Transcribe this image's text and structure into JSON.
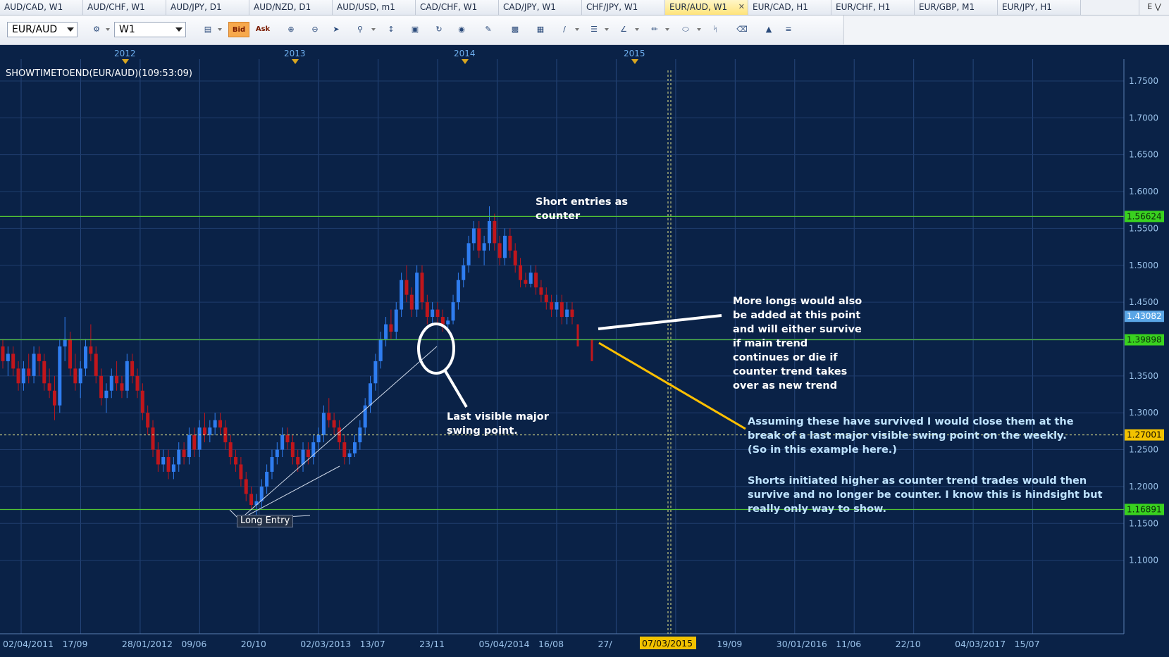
{
  "tabs": [
    {
      "label": "AUD/CAD, W1",
      "active": false
    },
    {
      "label": "AUD/CHF, W1",
      "active": false
    },
    {
      "label": "AUD/JPY, D1",
      "active": false
    },
    {
      "label": "AUD/NZD, D1",
      "active": false
    },
    {
      "label": "AUD/USD, m1",
      "active": false
    },
    {
      "label": "CAD/CHF, W1",
      "active": false
    },
    {
      "label": "CAD/JPY, W1",
      "active": false
    },
    {
      "label": "CHF/JPY, W1",
      "active": false
    },
    {
      "label": "EUR/AUD, W1",
      "active": true
    },
    {
      "label": "EUR/CAD, H1",
      "active": false
    },
    {
      "label": "EUR/CHF, H1",
      "active": false
    },
    {
      "label": "EUR/GBP, M1",
      "active": false
    },
    {
      "label": "EUR/JPY, H1",
      "active": false
    }
  ],
  "tab_more_label": "E",
  "toolbar": {
    "symbol": "EUR/AUD",
    "timeframe": "W1",
    "bid_label": "Bid",
    "ask_label": "Ask"
  },
  "indicator_label": "SHOWTIMETOEND(EUR/AUD)(109:53:09)",
  "annotations": {
    "short_entries": [
      "Short entries as",
      "counter"
    ],
    "more_longs": [
      "More longs would also",
      "be added at this point",
      "and will either survive",
      "if main trend",
      "continues or die if",
      "counter trend takes",
      "over as new trend"
    ],
    "swing_point": [
      "Last visible major",
      "swing point."
    ],
    "assuming": [
      "Assuming these have survived I would close them at the",
      "break of a last major visible swing point on the weekly.",
      "(So in this example here.)"
    ],
    "shorts": [
      "Shorts initiated higher as counter trend trades would then",
      "survive and no longer be counter. I know this is hindsight but",
      "really only way to show."
    ],
    "long_entry": "Long Entry"
  },
  "colors": {
    "background": "#0b2450",
    "bull": "#2f7df0",
    "bear": "#c0161c",
    "level_line": "#52c234",
    "crosshair": "#e6e68a",
    "current_price_tag": "#5aa6e6",
    "level_tag": "#39d11f",
    "crosshair_tag": "#f2c200",
    "arrow_long": "#ffffff",
    "arrow_short": "#ffc000"
  },
  "chart_data": {
    "type": "candlestick",
    "symbol": "EUR/AUD",
    "timeframe": "W1",
    "y_range": [
      1.05,
      1.77
    ],
    "y_ticks": [
      1.1,
      1.15,
      1.2,
      1.25,
      1.3,
      1.35,
      1.4,
      1.45,
      1.5,
      1.55,
      1.6,
      1.65,
      1.7,
      1.75
    ],
    "y_tick_labels": [
      "1.1000",
      "1.1500",
      "1.2000",
      "1.2500",
      "1.3000",
      "1.3500",
      "1.4000",
      "1.4500",
      "1.5000",
      "1.5500",
      "1.6000",
      "1.6500",
      "1.7000",
      "1.7500"
    ],
    "x_tick_labels": [
      "02/04/2011",
      "17/09",
      "28/01/2012",
      "09/06",
      "20/10",
      "02/03/2013",
      "13/07",
      "23/11",
      "05/04/2014",
      "16/08",
      "27/",
      "2015",
      "19/09",
      "30/01/2016",
      "11/06",
      "22/10",
      "04/03/2017",
      "15/07"
    ],
    "year_markers": [
      "2012",
      "2013",
      "2014",
      "2015"
    ],
    "horizontal_levels": [
      {
        "price": 1.56624,
        "label": "1.56624"
      },
      {
        "price": 1.39898,
        "label": "1.39898"
      },
      {
        "price": 1.16891,
        "label": "1.16891"
      }
    ],
    "current_price": {
      "price": 1.43082,
      "label": "1.43082"
    },
    "crosshair": {
      "price": 1.27001,
      "label": "1.27001",
      "date": "07/03/2015"
    },
    "series": [
      {
        "o": 1.39,
        "h": 1.4,
        "l": 1.36,
        "c": 1.37
      },
      {
        "o": 1.37,
        "h": 1.39,
        "l": 1.35,
        "c": 1.38
      },
      {
        "o": 1.38,
        "h": 1.39,
        "l": 1.35,
        "c": 1.36
      },
      {
        "o": 1.36,
        "h": 1.37,
        "l": 1.33,
        "c": 1.34
      },
      {
        "o": 1.34,
        "h": 1.37,
        "l": 1.33,
        "c": 1.36
      },
      {
        "o": 1.36,
        "h": 1.38,
        "l": 1.34,
        "c": 1.35
      },
      {
        "o": 1.35,
        "h": 1.39,
        "l": 1.34,
        "c": 1.38
      },
      {
        "o": 1.38,
        "h": 1.39,
        "l": 1.35,
        "c": 1.37
      },
      {
        "o": 1.37,
        "h": 1.38,
        "l": 1.33,
        "c": 1.34
      },
      {
        "o": 1.34,
        "h": 1.36,
        "l": 1.32,
        "c": 1.33
      },
      {
        "o": 1.33,
        "h": 1.35,
        "l": 1.29,
        "c": 1.31
      },
      {
        "o": 1.31,
        "h": 1.4,
        "l": 1.3,
        "c": 1.39
      },
      {
        "o": 1.39,
        "h": 1.43,
        "l": 1.37,
        "c": 1.4
      },
      {
        "o": 1.4,
        "h": 1.41,
        "l": 1.35,
        "c": 1.36
      },
      {
        "o": 1.36,
        "h": 1.38,
        "l": 1.33,
        "c": 1.34
      },
      {
        "o": 1.34,
        "h": 1.37,
        "l": 1.32,
        "c": 1.36
      },
      {
        "o": 1.36,
        "h": 1.4,
        "l": 1.35,
        "c": 1.39
      },
      {
        "o": 1.39,
        "h": 1.42,
        "l": 1.37,
        "c": 1.38
      },
      {
        "o": 1.38,
        "h": 1.39,
        "l": 1.34,
        "c": 1.35
      },
      {
        "o": 1.35,
        "h": 1.36,
        "l": 1.31,
        "c": 1.32
      },
      {
        "o": 1.32,
        "h": 1.34,
        "l": 1.3,
        "c": 1.33
      },
      {
        "o": 1.33,
        "h": 1.36,
        "l": 1.32,
        "c": 1.35
      },
      {
        "o": 1.35,
        "h": 1.37,
        "l": 1.33,
        "c": 1.34
      },
      {
        "o": 1.34,
        "h": 1.35,
        "l": 1.32,
        "c": 1.33
      },
      {
        "o": 1.33,
        "h": 1.38,
        "l": 1.32,
        "c": 1.37
      },
      {
        "o": 1.37,
        "h": 1.38,
        "l": 1.34,
        "c": 1.35
      },
      {
        "o": 1.35,
        "h": 1.36,
        "l": 1.32,
        "c": 1.33
      },
      {
        "o": 1.33,
        "h": 1.34,
        "l": 1.29,
        "c": 1.3
      },
      {
        "o": 1.3,
        "h": 1.31,
        "l": 1.27,
        "c": 1.28
      },
      {
        "o": 1.28,
        "h": 1.29,
        "l": 1.24,
        "c": 1.25
      },
      {
        "o": 1.25,
        "h": 1.26,
        "l": 1.22,
        "c": 1.23
      },
      {
        "o": 1.23,
        "h": 1.25,
        "l": 1.22,
        "c": 1.24
      },
      {
        "o": 1.24,
        "h": 1.25,
        "l": 1.21,
        "c": 1.22
      },
      {
        "o": 1.22,
        "h": 1.24,
        "l": 1.21,
        "c": 1.23
      },
      {
        "o": 1.23,
        "h": 1.26,
        "l": 1.22,
        "c": 1.25
      },
      {
        "o": 1.25,
        "h": 1.26,
        "l": 1.23,
        "c": 1.24
      },
      {
        "o": 1.24,
        "h": 1.28,
        "l": 1.23,
        "c": 1.27
      },
      {
        "o": 1.27,
        "h": 1.28,
        "l": 1.24,
        "c": 1.25
      },
      {
        "o": 1.25,
        "h": 1.29,
        "l": 1.24,
        "c": 1.28
      },
      {
        "o": 1.28,
        "h": 1.3,
        "l": 1.26,
        "c": 1.27
      },
      {
        "o": 1.27,
        "h": 1.29,
        "l": 1.26,
        "c": 1.28
      },
      {
        "o": 1.28,
        "h": 1.3,
        "l": 1.27,
        "c": 1.29
      },
      {
        "o": 1.29,
        "h": 1.3,
        "l": 1.27,
        "c": 1.28
      },
      {
        "o": 1.28,
        "h": 1.29,
        "l": 1.25,
        "c": 1.26
      },
      {
        "o": 1.26,
        "h": 1.27,
        "l": 1.23,
        "c": 1.24
      },
      {
        "o": 1.24,
        "h": 1.25,
        "l": 1.22,
        "c": 1.23
      },
      {
        "o": 1.23,
        "h": 1.24,
        "l": 1.2,
        "c": 1.21
      },
      {
        "o": 1.21,
        "h": 1.22,
        "l": 1.18,
        "c": 1.19
      },
      {
        "o": 1.19,
        "h": 1.2,
        "l": 1.17,
        "c": 1.175
      },
      {
        "o": 1.175,
        "h": 1.19,
        "l": 1.16,
        "c": 1.18
      },
      {
        "o": 1.18,
        "h": 1.21,
        "l": 1.17,
        "c": 1.2
      },
      {
        "o": 1.2,
        "h": 1.23,
        "l": 1.19,
        "c": 1.22
      },
      {
        "o": 1.22,
        "h": 1.25,
        "l": 1.21,
        "c": 1.24
      },
      {
        "o": 1.24,
        "h": 1.26,
        "l": 1.23,
        "c": 1.25
      },
      {
        "o": 1.25,
        "h": 1.28,
        "l": 1.24,
        "c": 1.27
      },
      {
        "o": 1.27,
        "h": 1.28,
        "l": 1.25,
        "c": 1.26
      },
      {
        "o": 1.26,
        "h": 1.27,
        "l": 1.23,
        "c": 1.24
      },
      {
        "o": 1.24,
        "h": 1.25,
        "l": 1.22,
        "c": 1.23
      },
      {
        "o": 1.23,
        "h": 1.26,
        "l": 1.22,
        "c": 1.25
      },
      {
        "o": 1.25,
        "h": 1.26,
        "l": 1.23,
        "c": 1.24
      },
      {
        "o": 1.24,
        "h": 1.27,
        "l": 1.23,
        "c": 1.26
      },
      {
        "o": 1.26,
        "h": 1.28,
        "l": 1.25,
        "c": 1.27
      },
      {
        "o": 1.27,
        "h": 1.31,
        "l": 1.26,
        "c": 1.3
      },
      {
        "o": 1.3,
        "h": 1.32,
        "l": 1.28,
        "c": 1.29
      },
      {
        "o": 1.29,
        "h": 1.3,
        "l": 1.27,
        "c": 1.28
      },
      {
        "o": 1.28,
        "h": 1.29,
        "l": 1.25,
        "c": 1.26
      },
      {
        "o": 1.26,
        "h": 1.27,
        "l": 1.23,
        "c": 1.24
      },
      {
        "o": 1.24,
        "h": 1.25,
        "l": 1.23,
        "c": 1.245
      },
      {
        "o": 1.245,
        "h": 1.27,
        "l": 1.24,
        "c": 1.26
      },
      {
        "o": 1.26,
        "h": 1.29,
        "l": 1.25,
        "c": 1.28
      },
      {
        "o": 1.28,
        "h": 1.32,
        "l": 1.27,
        "c": 1.31
      },
      {
        "o": 1.31,
        "h": 1.35,
        "l": 1.3,
        "c": 1.34
      },
      {
        "o": 1.34,
        "h": 1.38,
        "l": 1.33,
        "c": 1.37
      },
      {
        "o": 1.37,
        "h": 1.41,
        "l": 1.36,
        "c": 1.4
      },
      {
        "o": 1.4,
        "h": 1.43,
        "l": 1.39,
        "c": 1.42
      },
      {
        "o": 1.42,
        "h": 1.44,
        "l": 1.4,
        "c": 1.41
      },
      {
        "o": 1.41,
        "h": 1.45,
        "l": 1.4,
        "c": 1.44
      },
      {
        "o": 1.44,
        "h": 1.49,
        "l": 1.43,
        "c": 1.48
      },
      {
        "o": 1.48,
        "h": 1.5,
        "l": 1.45,
        "c": 1.46
      },
      {
        "o": 1.46,
        "h": 1.47,
        "l": 1.43,
        "c": 1.44
      },
      {
        "o": 1.44,
        "h": 1.5,
        "l": 1.43,
        "c": 1.49
      },
      {
        "o": 1.49,
        "h": 1.5,
        "l": 1.44,
        "c": 1.45
      },
      {
        "o": 1.45,
        "h": 1.46,
        "l": 1.42,
        "c": 1.43
      },
      {
        "o": 1.43,
        "h": 1.45,
        "l": 1.42,
        "c": 1.44
      },
      {
        "o": 1.44,
        "h": 1.45,
        "l": 1.42,
        "c": 1.43
      },
      {
        "o": 1.43,
        "h": 1.44,
        "l": 1.41,
        "c": 1.42
      },
      {
        "o": 1.42,
        "h": 1.43,
        "l": 1.41,
        "c": 1.425
      },
      {
        "o": 1.425,
        "h": 1.46,
        "l": 1.42,
        "c": 1.45
      },
      {
        "o": 1.45,
        "h": 1.49,
        "l": 1.44,
        "c": 1.48
      },
      {
        "o": 1.48,
        "h": 1.51,
        "l": 1.47,
        "c": 1.5
      },
      {
        "o": 1.5,
        "h": 1.54,
        "l": 1.49,
        "c": 1.53
      },
      {
        "o": 1.53,
        "h": 1.56,
        "l": 1.52,
        "c": 1.55
      },
      {
        "o": 1.55,
        "h": 1.56,
        "l": 1.51,
        "c": 1.52
      },
      {
        "o": 1.52,
        "h": 1.54,
        "l": 1.5,
        "c": 1.53
      },
      {
        "o": 1.53,
        "h": 1.58,
        "l": 1.52,
        "c": 1.56
      },
      {
        "o": 1.56,
        "h": 1.57,
        "l": 1.52,
        "c": 1.53
      },
      {
        "o": 1.53,
        "h": 1.54,
        "l": 1.5,
        "c": 1.51
      },
      {
        "o": 1.51,
        "h": 1.55,
        "l": 1.5,
        "c": 1.54
      },
      {
        "o": 1.54,
        "h": 1.55,
        "l": 1.51,
        "c": 1.52
      },
      {
        "o": 1.52,
        "h": 1.53,
        "l": 1.49,
        "c": 1.5
      },
      {
        "o": 1.5,
        "h": 1.51,
        "l": 1.47,
        "c": 1.48
      },
      {
        "o": 1.48,
        "h": 1.49,
        "l": 1.47,
        "c": 1.475
      },
      {
        "o": 1.475,
        "h": 1.5,
        "l": 1.47,
        "c": 1.49
      },
      {
        "o": 1.49,
        "h": 1.5,
        "l": 1.46,
        "c": 1.47
      },
      {
        "o": 1.47,
        "h": 1.48,
        "l": 1.45,
        "c": 1.46
      },
      {
        "o": 1.46,
        "h": 1.47,
        "l": 1.44,
        "c": 1.45
      },
      {
        "o": 1.45,
        "h": 1.46,
        "l": 1.43,
        "c": 1.44
      },
      {
        "o": 1.44,
        "h": 1.46,
        "l": 1.43,
        "c": 1.45
      },
      {
        "o": 1.45,
        "h": 1.46,
        "l": 1.42,
        "c": 1.43
      },
      {
        "o": 1.43,
        "h": 1.45,
        "l": 1.42,
        "c": 1.44
      },
      {
        "o": 1.44,
        "h": 1.45,
        "l": 1.42,
        "c": 1.43
      }
    ],
    "manual_bars": [
      {
        "o": 1.42,
        "h": 1.42,
        "l": 1.39,
        "c": 1.39
      },
      {
        "o": 1.4,
        "h": 1.4,
        "l": 1.37,
        "c": 1.37
      }
    ]
  }
}
